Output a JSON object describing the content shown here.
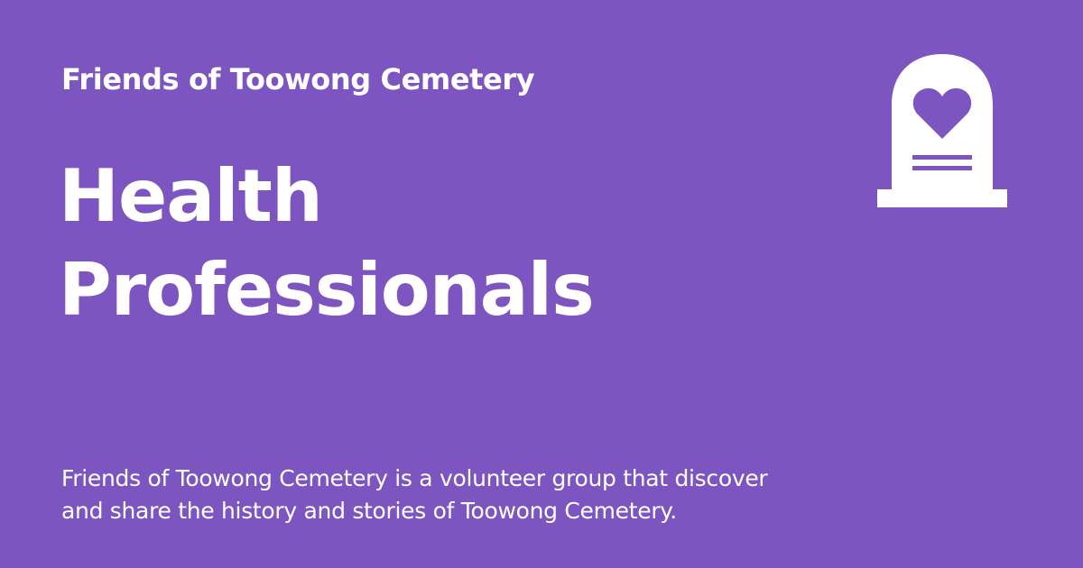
{
  "header": {
    "organization": "Friends of Toowong Cemetery"
  },
  "main": {
    "title_line_1": "Health",
    "title_line_2": "Professionals",
    "description_line_1": "Friends of Toowong Cemetery is a volunteer group that discover",
    "description_line_2": "and share the history and stories of Toowong Cemetery."
  },
  "theme": {
    "background_color": "#7c55c1",
    "text_color": "#ffffff",
    "logo_color": "#ffffff"
  },
  "icons": {
    "logo": "headstone-heart-icon"
  }
}
